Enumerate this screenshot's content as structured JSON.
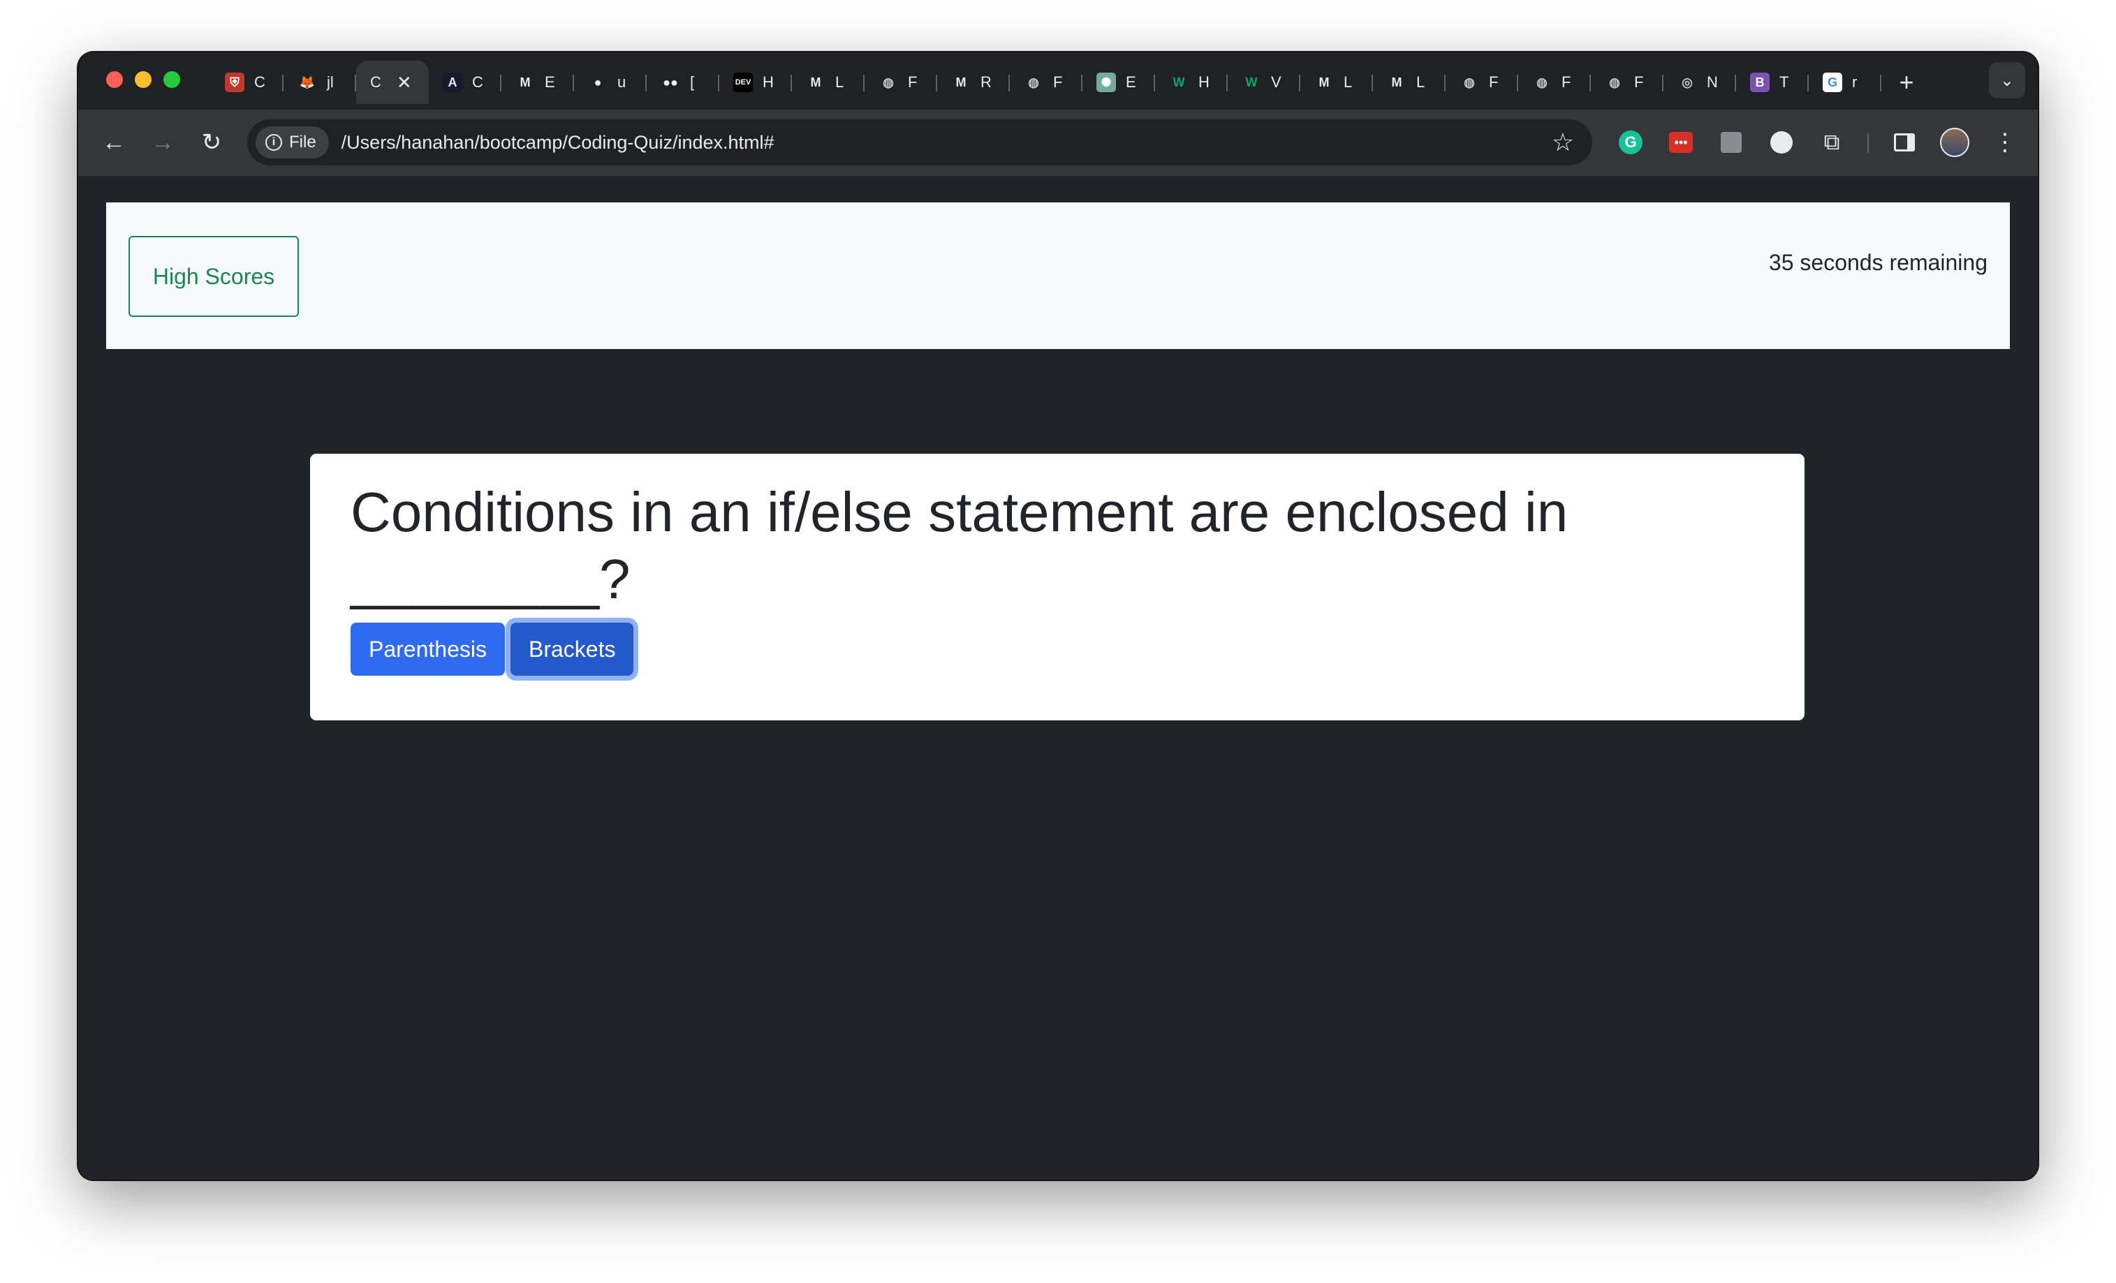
{
  "browser": {
    "tabs": [
      {
        "favicon": "university-crest-icon",
        "label": "C",
        "active": false
      },
      {
        "favicon": "gitlab-icon",
        "label": "jl",
        "active": false
      },
      {
        "favicon": "",
        "label": "C",
        "active": true
      },
      {
        "favicon": "angular-icon",
        "label": "C",
        "active": false
      },
      {
        "favicon": "mdn-icon",
        "label": "E",
        "active": false
      },
      {
        "favicon": "github-icon",
        "label": "u",
        "active": false
      },
      {
        "favicon": "medium-icon",
        "label": "[",
        "active": false
      },
      {
        "favicon": "dev-icon",
        "label": "H",
        "active": false
      },
      {
        "favicon": "mdn-icon",
        "label": "L",
        "active": false
      },
      {
        "favicon": "globe-icon",
        "label": "F",
        "active": false
      },
      {
        "favicon": "mdn-icon",
        "label": "R",
        "active": false
      },
      {
        "favicon": "globe-icon",
        "label": "F",
        "active": false
      },
      {
        "favicon": "chatgpt-icon",
        "label": "E",
        "active": false
      },
      {
        "favicon": "w3schools-icon",
        "label": "H",
        "active": false
      },
      {
        "favicon": "w3schools-icon",
        "label": "V",
        "active": false
      },
      {
        "favicon": "mdn-icon",
        "label": "L",
        "active": false
      },
      {
        "favicon": "mdn-icon",
        "label": "L",
        "active": false
      },
      {
        "favicon": "globe-icon",
        "label": "F",
        "active": false
      },
      {
        "favicon": "globe-icon",
        "label": "F",
        "active": false
      },
      {
        "favicon": "globe-icon",
        "label": "F",
        "active": false
      },
      {
        "favicon": "chrome-icon",
        "label": "N",
        "active": false
      },
      {
        "favicon": "bootstrap-icon",
        "label": "T",
        "active": false
      },
      {
        "favicon": "google-icon",
        "label": "r",
        "active": false
      }
    ],
    "address": {
      "chip_label": "File",
      "url": "/Users/hanahan/bootcamp/Coding-Quiz/index.html#"
    }
  },
  "page": {
    "navbar": {
      "high_scores_label": "High Scores",
      "timer_text": "35 seconds remaining"
    },
    "quiz": {
      "question": "Conditions in an if/else statement are enclosed in ________?",
      "answers": [
        "Parenthesis",
        "Brackets"
      ]
    }
  },
  "colors": {
    "success": "#198754",
    "primary": "#2f6bf0",
    "page_bg": "#212529",
    "navbar_bg": "#f8f9fa"
  }
}
